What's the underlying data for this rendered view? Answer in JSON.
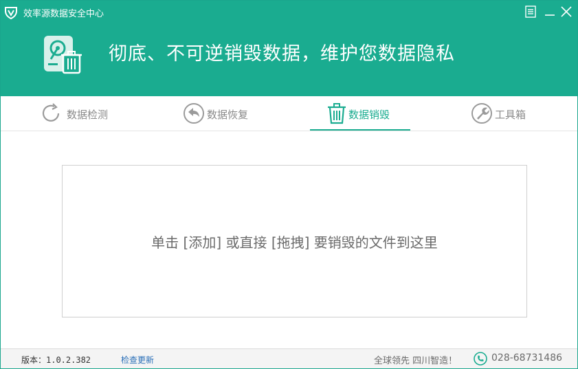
{
  "window": {
    "title": "效率源数据安全中心"
  },
  "banner": {
    "text": "彻底、不可逆销毁数据，维护您数据隐私"
  },
  "tabs": [
    {
      "label": "数据检测",
      "icon": "refresh-icon"
    },
    {
      "label": "数据恢复",
      "icon": "back-arrow-icon"
    },
    {
      "label": "数据销毁",
      "icon": "trash-icon",
      "active": true
    },
    {
      "label": "工具箱",
      "icon": "wrench-icon"
    }
  ],
  "dropzone": {
    "text": "单击 [添加] 或直接 [拖拽] 要销毁的文件到这里"
  },
  "status": {
    "version": "版本：1.0.2.382",
    "update_link": "检查更新",
    "slogan": "全球领先 四川智造！",
    "phone": "028-68731486"
  },
  "colors": {
    "accent": "#1aac90",
    "tab_inactive": "#8a8a8a",
    "link": "#2a6fb8"
  }
}
